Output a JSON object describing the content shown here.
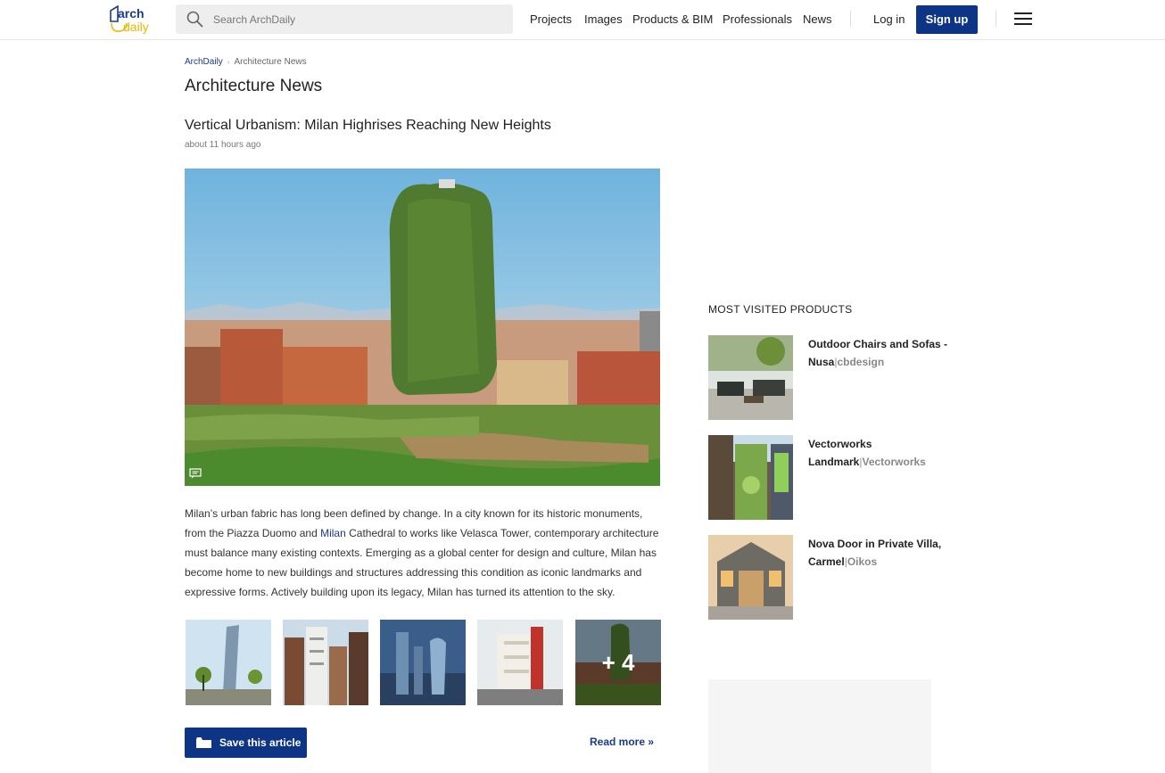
{
  "header": {
    "logo_line1": "arch",
    "logo_line2": "daily",
    "search_placeholder": "Search ArchDaily",
    "nav": [
      "Projects",
      "Images",
      "Products & BIM",
      "Professionals",
      "News"
    ],
    "login": "Log in",
    "signup": "Sign up"
  },
  "breadcrumb": {
    "home": "ArchDaily",
    "current": "Architecture News"
  },
  "page_title": "Architecture News",
  "article": {
    "title": "Vertical Urbanism: Milan Highrises Reaching New Heights",
    "time": "about 11 hours ago",
    "body_part1": "Milan’s urban fabric has long been defined by change. In a city known for its historic monuments, from the Piazza Duomo and ",
    "body_link": "Milan",
    "body_part2": " Cathedral to works like Velasca Tower, contemporary architecture must balance many existing contexts. Emerging as a global center for design and culture, Milan has become home to new buildings and structures addressing this condition as iconic landmarks and expressive forms. Actively building upon its legacy, Milan has turned its attention to the sky.",
    "more_count": "+ 4",
    "save_label": "Save this article",
    "read_more": "Read more »"
  },
  "sidebar": {
    "heading": "MOST VISITED PRODUCTS",
    "products": [
      {
        "name": "Outdoor Chairs and Sofas - Nusa",
        "brand": "cbdesign"
      },
      {
        "name": "Vectorworks Landmark",
        "brand": "Vectorworks"
      },
      {
        "name": "Nova Door in Private Villa, Carmel",
        "brand": "Oikos"
      }
    ]
  },
  "colors": {
    "brand_blue": "#0e3486",
    "link_blue": "#1a3a8a",
    "logo_yellow": "#e8b900"
  }
}
